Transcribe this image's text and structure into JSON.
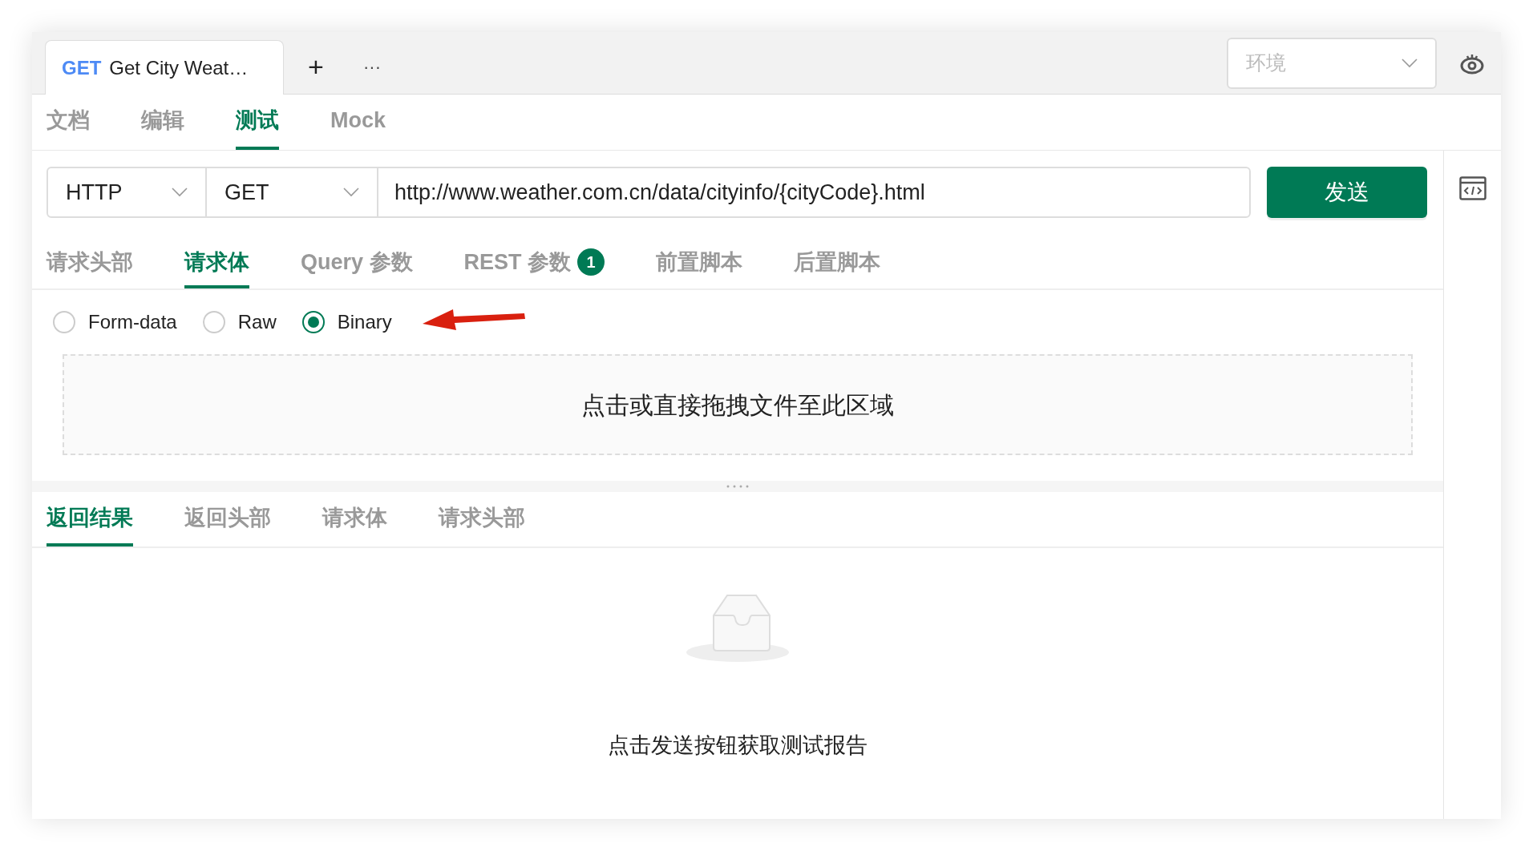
{
  "request_tabs": [
    {
      "method": "GET",
      "title": "Get City Weat…",
      "selected": true
    }
  ],
  "tab_actions": {
    "add": "+",
    "more": "···"
  },
  "environment": {
    "placeholder": "环境"
  },
  "view_tabs": [
    {
      "label": "文档",
      "selected": false
    },
    {
      "label": "编辑",
      "selected": false
    },
    {
      "label": "测试",
      "selected": true
    },
    {
      "label": "Mock",
      "selected": false
    }
  ],
  "request": {
    "protocol": "HTTP",
    "method": "GET",
    "url": "http://www.weather.com.cn/data/cityinfo/{cityCode}.html",
    "send": "发送"
  },
  "param_tabs": [
    {
      "label": "请求头部",
      "selected": false
    },
    {
      "label": "请求体",
      "selected": true
    },
    {
      "label": "Query 参数",
      "selected": false
    },
    {
      "label": "REST 参数",
      "badge": "1",
      "selected": false
    },
    {
      "label": "前置脚本",
      "selected": false
    },
    {
      "label": "后置脚本",
      "selected": false
    }
  ],
  "body_types": [
    {
      "label": "Form-data",
      "selected": false
    },
    {
      "label": "Raw",
      "selected": false
    },
    {
      "label": "Binary",
      "selected": true
    }
  ],
  "dropzone": "点击或直接拖拽文件至此区域",
  "response_tabs": [
    {
      "label": "返回结果",
      "selected": true
    },
    {
      "label": "返回头部",
      "selected": false
    },
    {
      "label": "请求体",
      "selected": false
    },
    {
      "label": "请求头部",
      "selected": false
    }
  ],
  "empty_message": "点击发送按钮获取测试报告"
}
